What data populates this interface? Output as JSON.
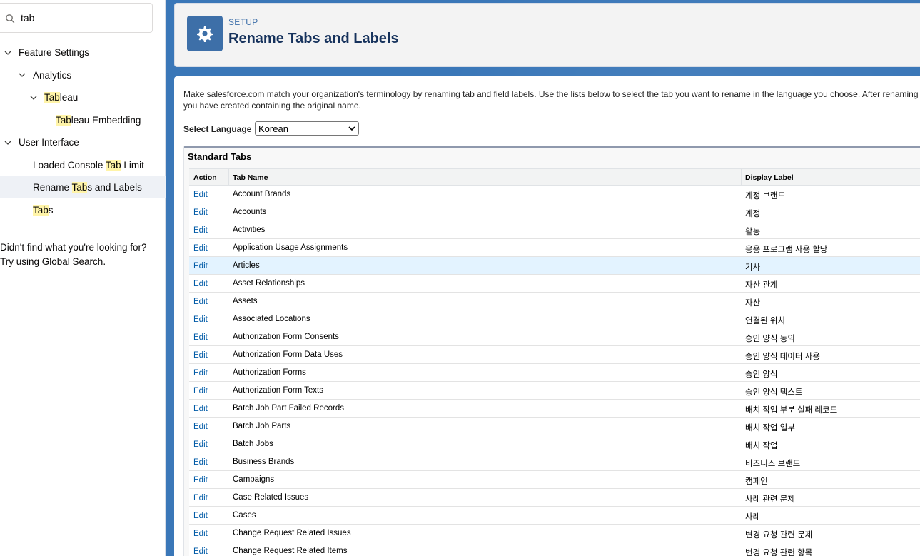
{
  "search": {
    "value": "tab"
  },
  "tree": [
    {
      "label_parts": [
        {
          "t": "Feature Settings",
          "h": false
        }
      ],
      "level": 0,
      "expanded": true,
      "selected": false
    },
    {
      "label_parts": [
        {
          "t": "Analytics",
          "h": false
        }
      ],
      "level": 1,
      "expanded": true,
      "selected": false
    },
    {
      "label_parts": [
        {
          "t": "Tab",
          "h": true
        },
        {
          "t": "leau",
          "h": false
        }
      ],
      "level": 2,
      "expanded": true,
      "selected": false
    },
    {
      "label_parts": [
        {
          "t": "Tab",
          "h": true
        },
        {
          "t": "leau Embedding",
          "h": false
        }
      ],
      "level": 3,
      "expanded": null,
      "selected": false
    },
    {
      "label_parts": [
        {
          "t": "User Interface",
          "h": false
        }
      ],
      "level": 0,
      "expanded": true,
      "selected": false
    },
    {
      "label_parts": [
        {
          "t": "Loaded Console ",
          "h": false
        },
        {
          "t": "Tab",
          "h": true
        },
        {
          "t": " Limit",
          "h": false
        }
      ],
      "level": 1,
      "expanded": null,
      "selected": false
    },
    {
      "label_parts": [
        {
          "t": "Rename ",
          "h": false
        },
        {
          "t": "Tab",
          "h": true
        },
        {
          "t": "s and Labels",
          "h": false
        }
      ],
      "level": 1,
      "expanded": null,
      "selected": true
    },
    {
      "label_parts": [
        {
          "t": "Tab",
          "h": true
        },
        {
          "t": "s",
          "h": false
        }
      ],
      "level": 1,
      "expanded": null,
      "selected": false
    }
  ],
  "not_found": {
    "line1": "Didn't find what you're looking for?",
    "line2": "Try using Global Search."
  },
  "header": {
    "eyebrow": "SETUP",
    "title": "Rename Tabs and Labels",
    "icon": "gear-icon"
  },
  "description": {
    "line1": "Make salesforce.com match your organization's terminology by renaming tab and field labels. Use the lists below to select the tab you want to rename in the language you choose. After renaming",
    "line2": "you have created containing the original name."
  },
  "language": {
    "label": "Select Language",
    "selected": "Korean"
  },
  "standard_tabs": {
    "title": "Standard Tabs",
    "columns": {
      "action": "Action",
      "tab_name": "Tab Name",
      "display_label": "Display Label"
    },
    "edit_label": "Edit",
    "rows": [
      {
        "name": "Account Brands",
        "label": "계정 브랜드"
      },
      {
        "name": "Accounts",
        "label": "계정"
      },
      {
        "name": "Activities",
        "label": "활동"
      },
      {
        "name": "Application Usage Assignments",
        "label": "응용 프로그램 사용 할당"
      },
      {
        "name": "Articles",
        "label": "기사",
        "hover": true
      },
      {
        "name": "Asset Relationships",
        "label": "자산 관계"
      },
      {
        "name": "Assets",
        "label": "자산"
      },
      {
        "name": "Associated Locations",
        "label": "연결된 위치"
      },
      {
        "name": "Authorization Form Consents",
        "label": "승인 양식 동의"
      },
      {
        "name": "Authorization Form Data Uses",
        "label": "승인 양식 데이터 사용"
      },
      {
        "name": "Authorization Forms",
        "label": "승인 양식"
      },
      {
        "name": "Authorization Form Texts",
        "label": "승인 양식 텍스트"
      },
      {
        "name": "Batch Job Part Failed Records",
        "label": "배치 작업 부분 실패 레코드"
      },
      {
        "name": "Batch Job Parts",
        "label": "배치 작업 일부"
      },
      {
        "name": "Batch Jobs",
        "label": "배치 작업"
      },
      {
        "name": "Business Brands",
        "label": "비즈니스 브랜드"
      },
      {
        "name": "Campaigns",
        "label": "캠페인"
      },
      {
        "name": "Case Related Issues",
        "label": "사례 관련 문제"
      },
      {
        "name": "Cases",
        "label": "사례"
      },
      {
        "name": "Change Request Related Issues",
        "label": "변경 요청 관련 문제"
      },
      {
        "name": "Change Request Related Items",
        "label": "변경 요청 관련 항목"
      }
    ]
  }
}
